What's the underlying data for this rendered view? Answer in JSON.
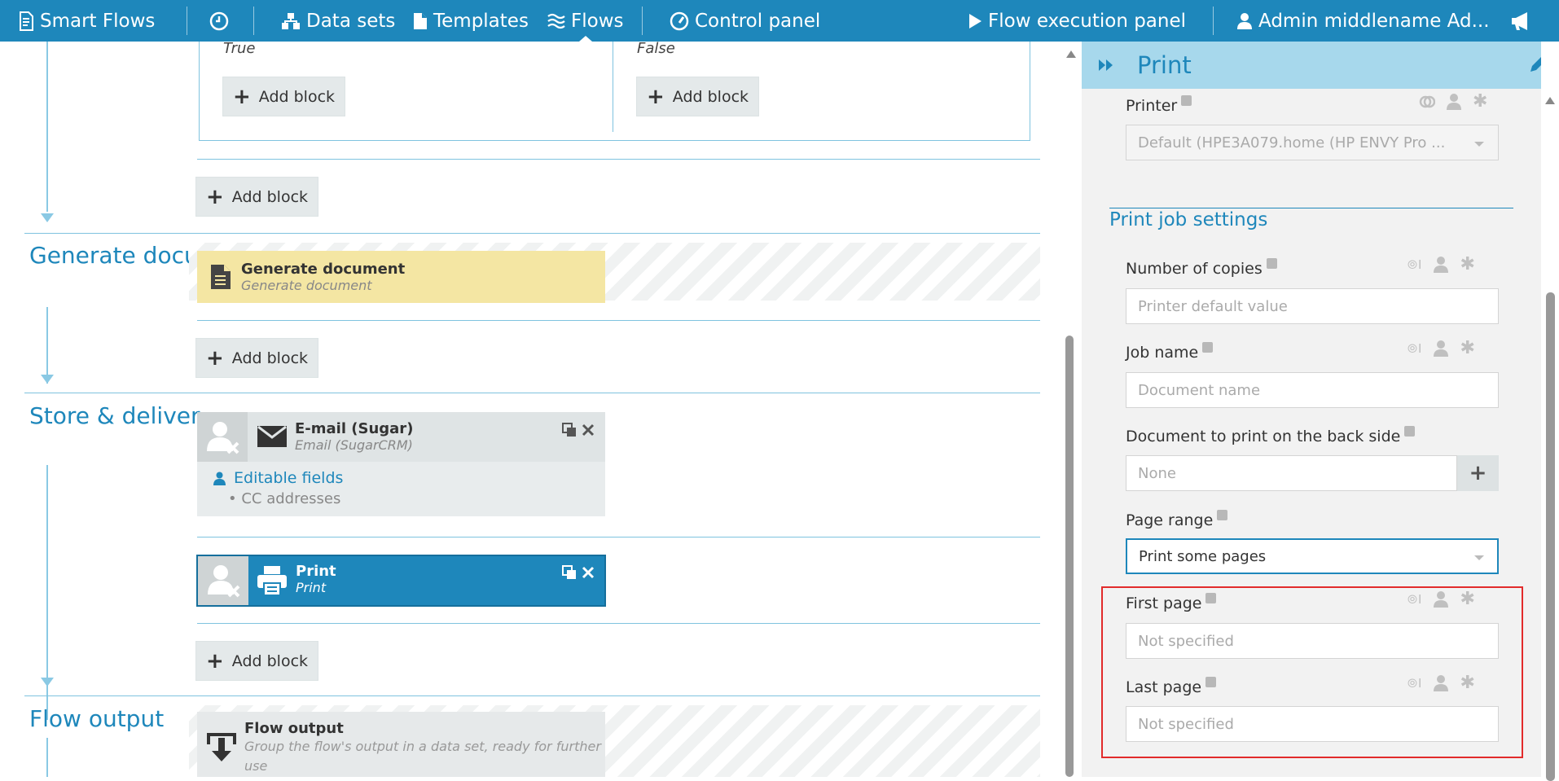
{
  "nav": {
    "brand": "Smart Flows",
    "items": [
      {
        "label": "Data sets",
        "icon": "data-sets-icon"
      },
      {
        "label": "Templates",
        "icon": "document-icon"
      },
      {
        "label": "Flows",
        "icon": "flows-icon",
        "active": true
      },
      {
        "label": "Control panel",
        "icon": "gauge-icon"
      }
    ],
    "execution_panel": "Flow execution panel",
    "user": "Admin middlename Ad...",
    "colors": {
      "bar": "#1e87bb",
      "accent": "#1e87bb",
      "highlight": "#e22b2b"
    }
  },
  "editor": {
    "branches": {
      "true_label": "True",
      "false_label": "False"
    },
    "add_block_label": "Add block",
    "sections": [
      {
        "title": "Generate documents"
      },
      {
        "title": "Store & deliver"
      },
      {
        "title": "Flow output"
      }
    ],
    "blocks": {
      "generate": {
        "title": "Generate document",
        "subtitle": "Generate document"
      },
      "email": {
        "title": "E-mail (Sugar)",
        "subtitle": "Email (SugarCRM)",
        "editable_fields_label": "Editable fields",
        "editable_fields": [
          "CC addresses"
        ]
      },
      "print": {
        "title": "Print",
        "subtitle": "Print"
      },
      "flow_output": {
        "title": "Flow output",
        "subtitle": "Group the flow's output in a data set, ready for further use"
      }
    }
  },
  "panel": {
    "title": "Print",
    "printer": {
      "label": "Printer",
      "value": "Default (HPE3A079.home (HP ENVY Pro ..."
    },
    "section_title": "Print job settings",
    "copies": {
      "label": "Number of copies",
      "placeholder": "Printer default value"
    },
    "job_name": {
      "label": "Job name",
      "placeholder": "Document name"
    },
    "back_side": {
      "label": "Document to print on the back side",
      "value": "None"
    },
    "page_range": {
      "label": "Page range",
      "value": "Print some pages"
    },
    "first_page": {
      "label": "First page",
      "placeholder": "Not specified"
    },
    "last_page": {
      "label": "Last page",
      "placeholder": "Not specified"
    }
  }
}
